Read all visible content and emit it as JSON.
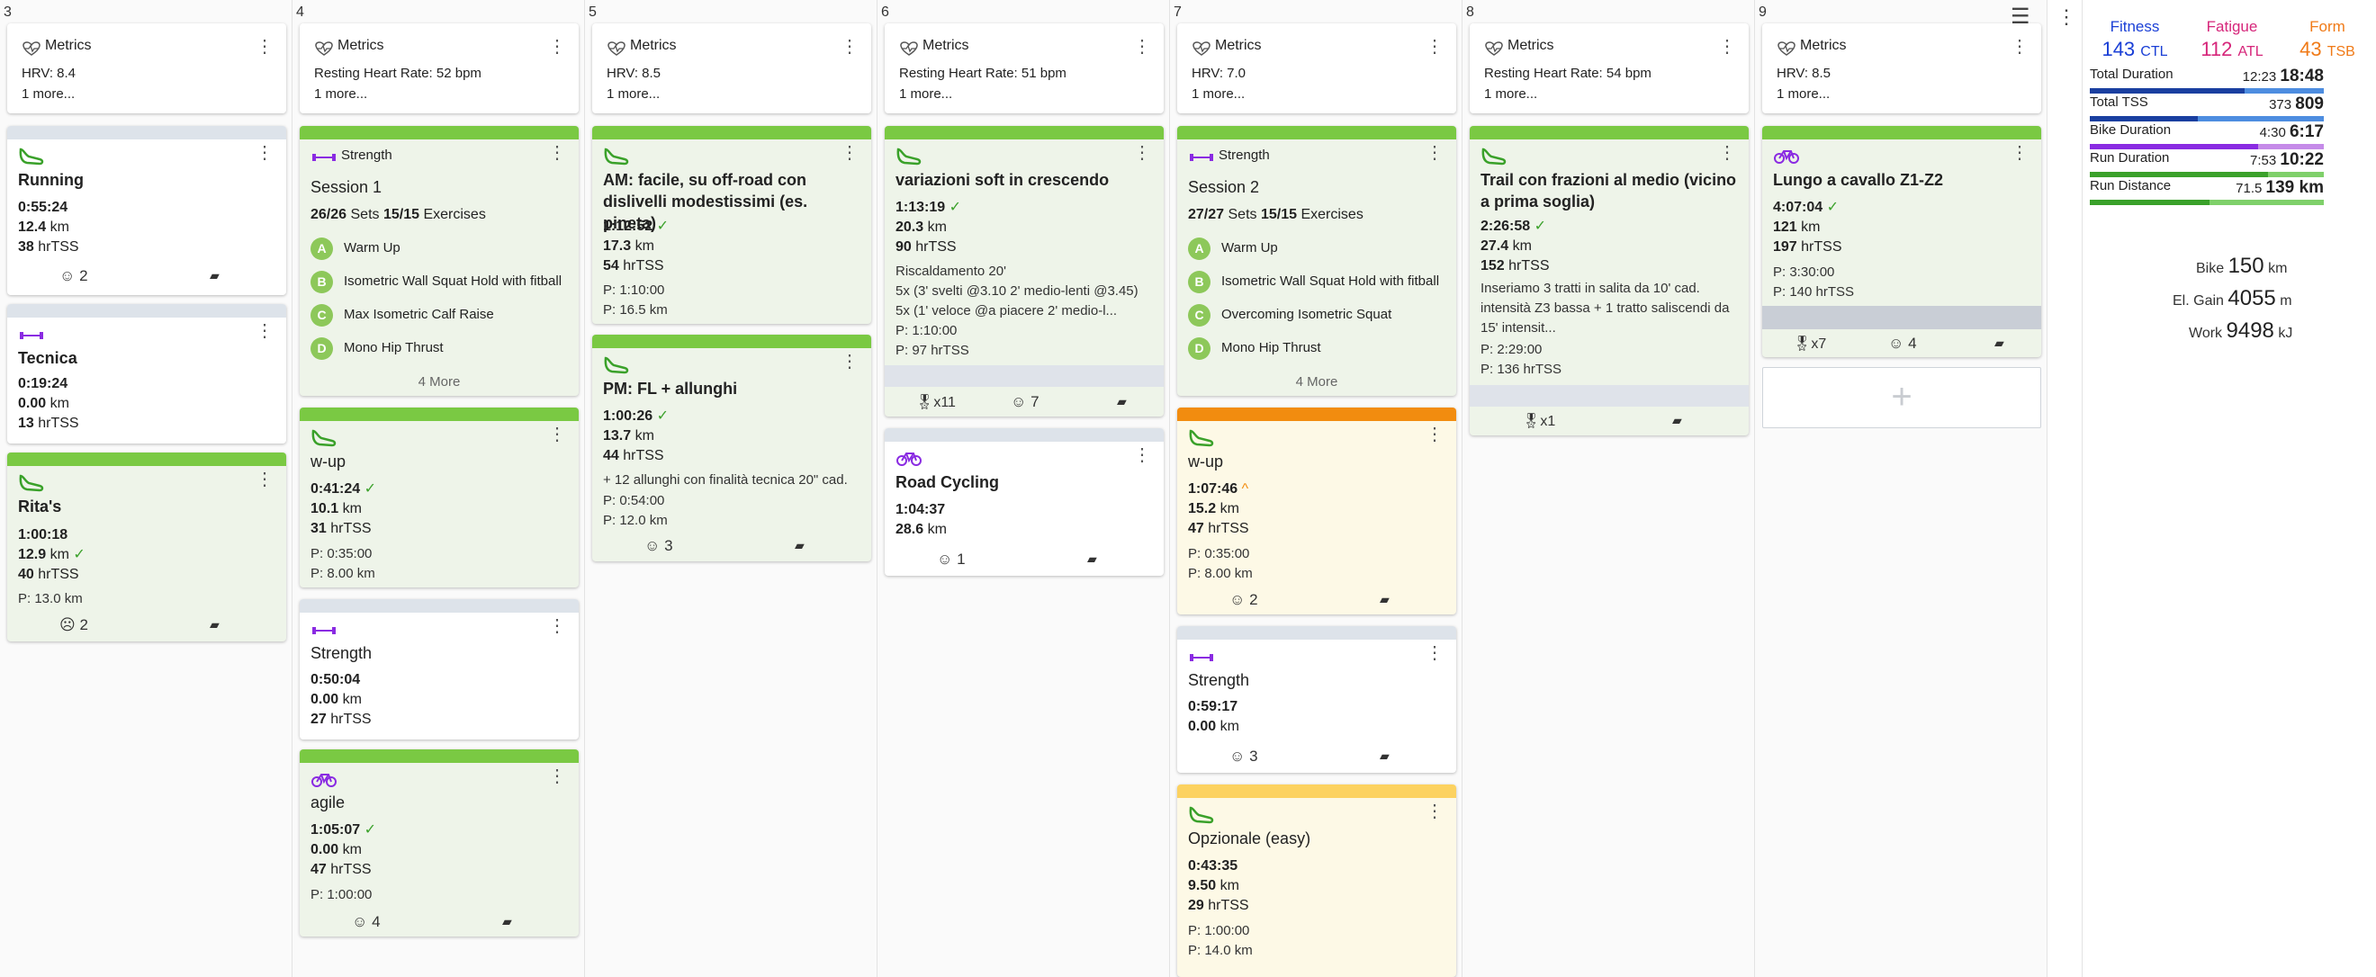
{
  "days": [
    {
      "num": "3"
    },
    {
      "num": "4"
    },
    {
      "num": "5"
    },
    {
      "num": "6"
    },
    {
      "num": "7"
    },
    {
      "num": "8"
    },
    {
      "num": "9"
    }
  ],
  "metrics_title": "Metrics",
  "metrics_more": "1 more...",
  "metrics": [
    "HRV: 8.4",
    "Resting Heart Rate: 52 bpm",
    "HRV: 8.5",
    "Resting Heart Rate: 51 bpm",
    "HRV: 7.0",
    "Resting Heart Rate: 54 bpm",
    "HRV: 8.5"
  ],
  "c3a": {
    "title": "Running",
    "l1": "0:55:24",
    "l2": "12.4",
    "u2": "km",
    "l3": "38",
    "u3": "hrTSS",
    "smile": "2"
  },
  "c3b": {
    "title": "Tecnica",
    "l1": "0:19:24",
    "l2": "0.00",
    "u2": "km",
    "l3": "13",
    "u3": "hrTSS"
  },
  "c3c": {
    "title": "Rita's",
    "l1": "1:00:18",
    "l2": "12.9",
    "u2": "km",
    "l3": "40",
    "u3": "hrTSS",
    "p1": "P: 13.0 km",
    "smile": "2"
  },
  "c4a": {
    "type": "Strength",
    "title": "Session 1",
    "sets": "26/26",
    "sets_l": "Sets",
    "ex": "15/15",
    "ex_l": "Exercises",
    "items": [
      {
        "k": "A",
        "n": "Warm Up"
      },
      {
        "k": "B",
        "n": "Isometric Wall Squat Hold with fitball"
      },
      {
        "k": "C",
        "n": "Max Isometric Calf Raise"
      },
      {
        "k": "D",
        "n": "Mono Hip Thrust"
      }
    ],
    "more": "4 More"
  },
  "c4b": {
    "title": "w-up",
    "l1": "0:41:24",
    "l2": "10.1",
    "u2": "km",
    "l3": "31",
    "u3": "hrTSS",
    "p1": "P: 0:35:00",
    "p2": "P: 8.00 km"
  },
  "c4c": {
    "title": "Strength",
    "l1": "0:50:04",
    "l2": "0.00",
    "u2": "km",
    "l3": "27",
    "u3": "hrTSS"
  },
  "c4d": {
    "title": "agile",
    "l1": "1:05:07",
    "l2": "0.00",
    "u2": "km",
    "l3": "47",
    "u3": "hrTSS",
    "p1": "P: 1:00:00",
    "smile": "4"
  },
  "c5a": {
    "title": "AM: facile, su off-road con dislivelli modestissimi (es. pineta)",
    "l1": "1:12:52",
    "l2": "17.3",
    "u2": "km",
    "l3": "54",
    "u3": "hrTSS",
    "p1": "P: 1:10:00",
    "p2": "P: 16.5 km"
  },
  "c5b": {
    "title": "PM: FL + allunghi",
    "l1": "1:00:26",
    "l2": "13.7",
    "u2": "km",
    "l3": "44",
    "u3": "hrTSS",
    "d1": "+ 12 allunghi con finalità tecnica 20\" cad.",
    "p1": "P: 0:54:00",
    "p2": "P: 12.0 km",
    "smile": "3"
  },
  "c6a": {
    "title": "variazioni soft in crescendo",
    "l1": "1:13:19",
    "l2": "20.3",
    "u2": "km",
    "l3": "90",
    "u3": "hrTSS",
    "d1": "Riscaldamento 20'",
    "d2": "5x (3' svelti @3.10 2' medio-lenti @3.45)",
    "d3": "5x (1' veloce @a piacere 2' medio-l...",
    "p1": "P: 1:10:00",
    "p2": "P: 97 hrTSS",
    "medal": "x11",
    "smile": "7"
  },
  "c6b": {
    "title": "Road Cycling",
    "l1": "1:04:37",
    "l2": "28.6",
    "u2": "km",
    "smile": "1"
  },
  "c7a": {
    "type": "Strength",
    "title": "Session 2",
    "sets": "27/27",
    "sets_l": "Sets",
    "ex": "15/15",
    "ex_l": "Exercises",
    "items": [
      {
        "k": "A",
        "n": "Warm Up"
      },
      {
        "k": "B",
        "n": "Isometric Wall Squat Hold with fitball"
      },
      {
        "k": "C",
        "n": "Overcoming Isometric Squat"
      },
      {
        "k": "D",
        "n": "Mono Hip Thrust"
      }
    ],
    "more": "4 More"
  },
  "c7b": {
    "title": "w-up",
    "l1": "1:07:46",
    "l2": "15.2",
    "u2": "km",
    "l3": "47",
    "u3": "hrTSS",
    "p1": "P: 0:35:00",
    "p2": "P: 8.00 km",
    "smile": "2"
  },
  "c7c": {
    "title": "Strength",
    "l1": "0:59:17",
    "l2": "0.00",
    "u2": "km",
    "smile": "3"
  },
  "c7d": {
    "title": "Opzionale (easy)",
    "l1": "0:43:35",
    "l2": "9.50",
    "u2": "km",
    "l3": "29",
    "u3": "hrTSS",
    "p1": "P: 1:00:00",
    "p2": "P: 14.0 km"
  },
  "c8a": {
    "title": "Trail con frazioni al medio (vicino a prima soglia)",
    "l1": "2:26:58",
    "l2": "27.4",
    "u2": "km",
    "l3": "152",
    "u3": "hrTSS",
    "d1": "Inseriamo 3 tratti in salita da 10' cad. intensità Z3 bassa + 1 tratto saliscendi da 15' intensit...",
    "p1": "P: 2:29:00",
    "p2": "P: 136 hrTSS",
    "medal": "x1"
  },
  "c9a": {
    "title": "Lungo a cavallo Z1-Z2",
    "l1": "4:07:04",
    "l2": "121",
    "u2": "km",
    "l3": "197",
    "u3": "hrTSS",
    "p1": "P: 3:30:00",
    "p2": "P: 140 hrTSS",
    "medal": "x7",
    "smile": "4"
  },
  "add_label": "+",
  "side": {
    "fitness": {
      "label": "Fitness",
      "value": "143",
      "unit": "CTL",
      "color": "#1a3fd6"
    },
    "fatigue": {
      "label": "Fatigue",
      "value": "112",
      "unit": "ATL",
      "color": "#d6257a"
    },
    "form": {
      "label": "Form",
      "value": "43",
      "unit": "TSB",
      "color": "#f07a17"
    },
    "rows": [
      {
        "label": "Total Duration",
        "cur": "12:23",
        "tot": "18:48",
        "frac": 0.66,
        "color": "#1a3fa0",
        "bg": "#4d8de0"
      },
      {
        "label": "Total TSS",
        "cur": "373",
        "tot": "809",
        "frac": 0.46,
        "color": "#1a3fa0",
        "bg": "#4d8de0"
      },
      {
        "label": "Bike Duration",
        "cur": "4:30",
        "tot": "6:17",
        "frac": 0.72,
        "color": "#8a2be2",
        "bg": "#c58be8"
      },
      {
        "label": "Run Duration",
        "cur": "7:53",
        "tot": "10:22",
        "frac": 0.76,
        "color": "#3aa12a",
        "bg": "#7fd06a"
      },
      {
        "label": "Run Distance",
        "cur": "71.5",
        "tot": "139 km",
        "frac": 0.51,
        "color": "#3aa12a",
        "bg": "#7fd06a"
      }
    ],
    "totals": [
      {
        "label": "Bike",
        "value": "150",
        "unit": "km"
      },
      {
        "label": "El. Gain",
        "value": "4055",
        "unit": "m"
      },
      {
        "label": "Work",
        "value": "9498",
        "unit": "kJ"
      }
    ]
  }
}
